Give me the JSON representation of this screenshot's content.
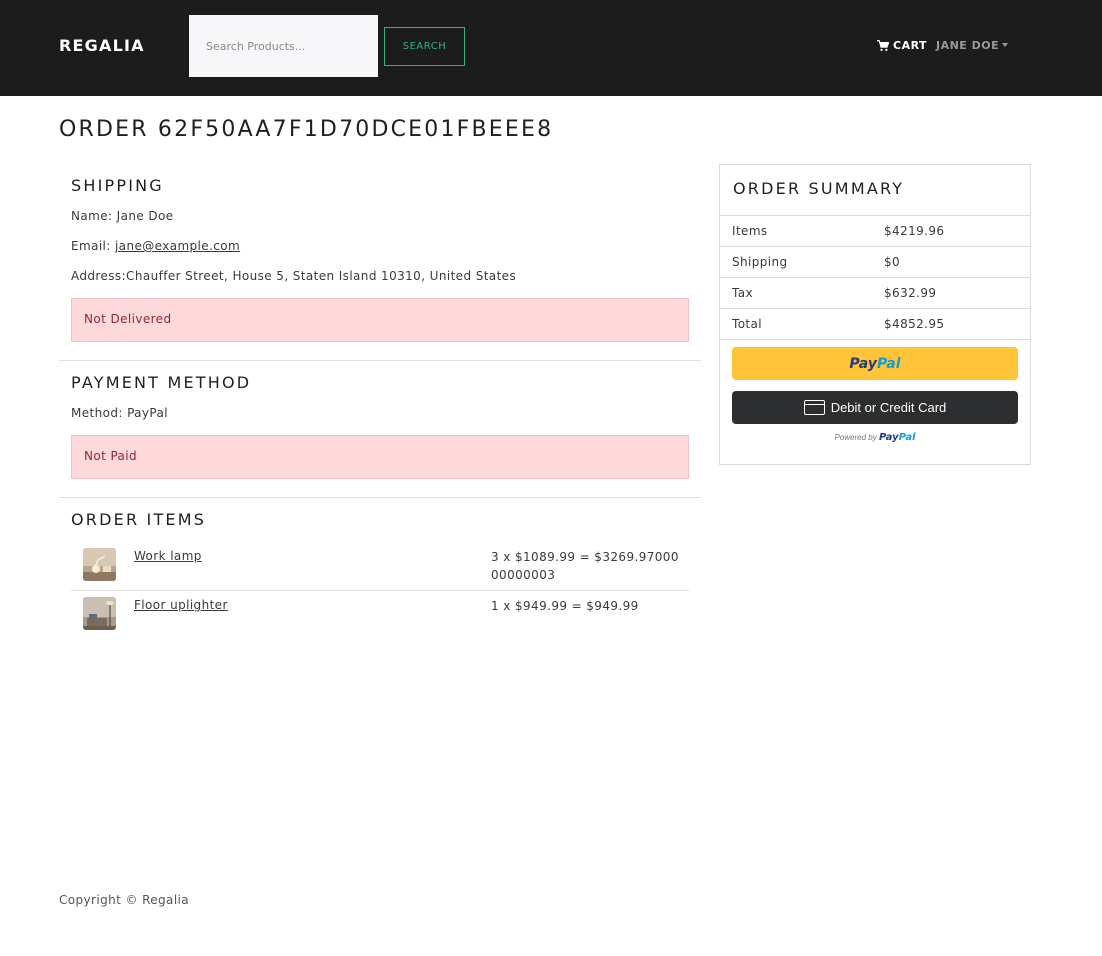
{
  "navbar": {
    "brand": "REGALIA",
    "search_placeholder": "Search Products...",
    "search_button": "SEARCH",
    "cart_label": "CART",
    "user_label": "JANE DOE"
  },
  "page": {
    "title": "ORDER 62F50AA7F1D70DCE01FBEEE8"
  },
  "shipping": {
    "heading": "SHIPPING",
    "name_label": "Name: ",
    "name": "Jane Doe",
    "email_label": "Email: ",
    "email": "jane@example.com",
    "address_label": "Address:",
    "address": "Chauffer Street, House 5, Staten Island 10310, United States",
    "status": "Not Delivered"
  },
  "payment": {
    "heading": "PAYMENT METHOD",
    "method_label": "Method: ",
    "method": "PayPal",
    "status": "Not Paid"
  },
  "order_items": {
    "heading": "ORDER ITEMS",
    "items": [
      {
        "name": "Work lamp",
        "price_line": "3 x $1089.99 = $3269.9700000000003"
      },
      {
        "name": "Floor uplighter",
        "price_line": "1 x $949.99 = $949.99"
      }
    ]
  },
  "summary": {
    "heading": "ORDER SUMMARY",
    "rows": [
      {
        "label": "Items",
        "value": "$4219.96"
      },
      {
        "label": "Shipping",
        "value": "$0"
      },
      {
        "label": "Tax",
        "value": "$632.99"
      },
      {
        "label": "Total",
        "value": "$4852.95"
      }
    ],
    "paypal_pay": "Pay",
    "paypal_pal": "Pal",
    "card_button": "Debit or Credit Card",
    "powered_by": "Powered by"
  },
  "footer": {
    "copyright": "Copyright © Regalia"
  },
  "colors": {
    "navbar_bg": "#1c1c1c",
    "accent_green": "#2fb380",
    "alert_bg": "#fdd9dc",
    "alert_text": "#8a2a33",
    "paypal_yellow": "#ffc439",
    "card_button_bg": "#2c2e2f"
  },
  "icons": {
    "cart": "cart-icon",
    "user_dropdown": "caret-down-icon",
    "card": "credit-card-icon"
  }
}
